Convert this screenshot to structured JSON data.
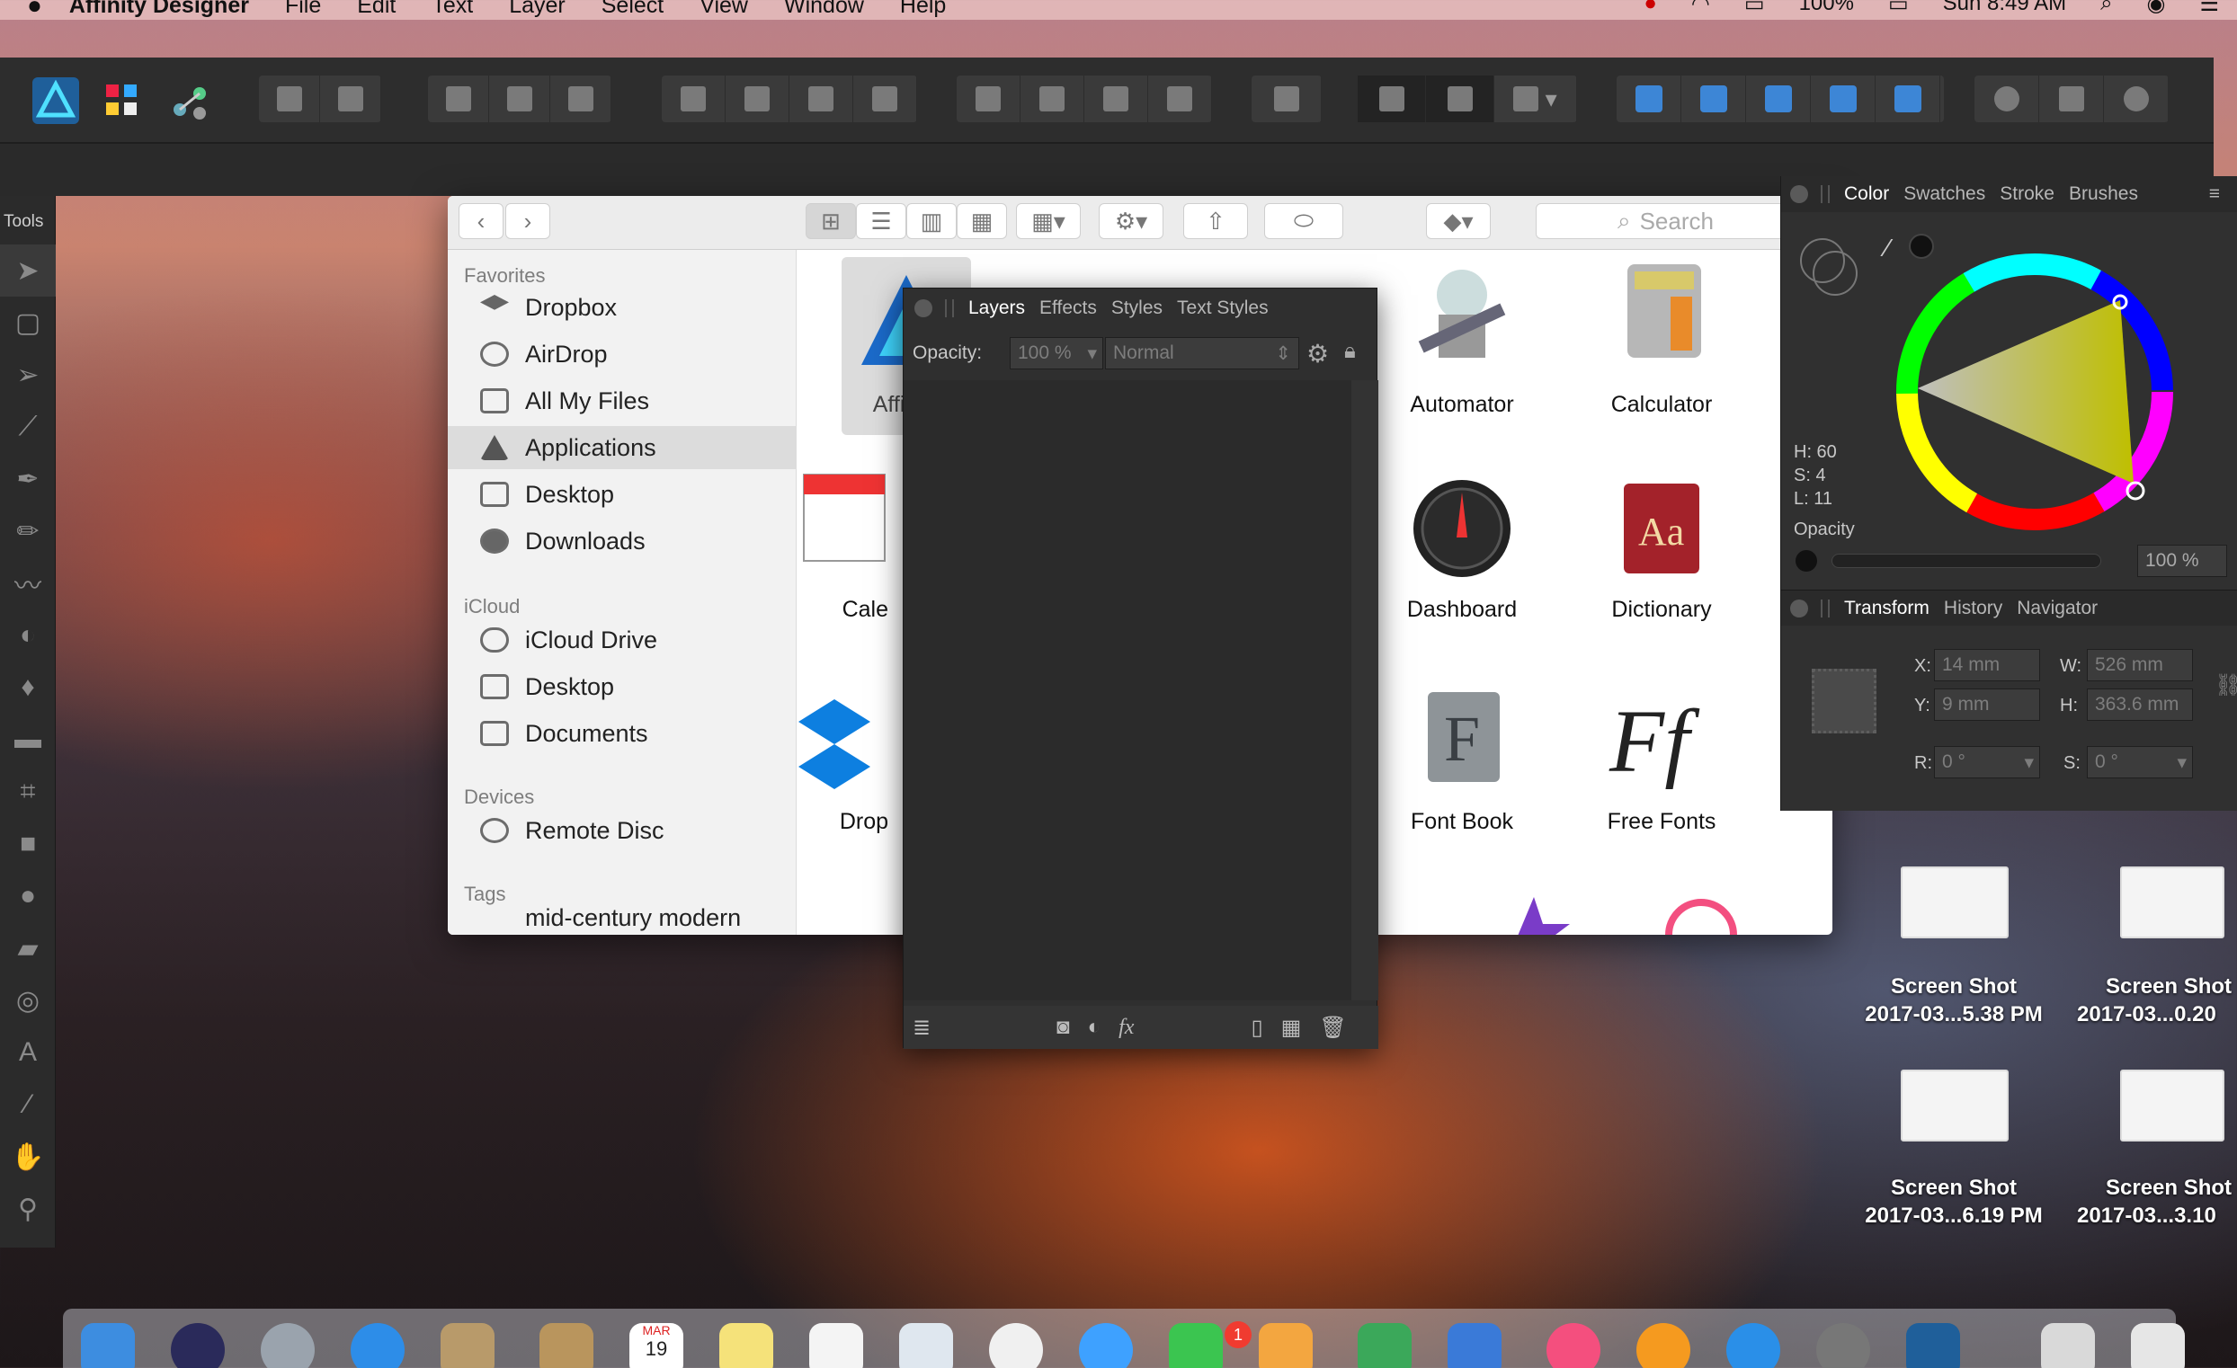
{
  "menubar": {
    "apple": "",
    "app": "Affinity Designer",
    "items": [
      "File",
      "Edit",
      "Text",
      "Layer",
      "Select",
      "View",
      "Window",
      "Help"
    ],
    "battery": "100%",
    "clock": "Sun 8:49 AM"
  },
  "tools": {
    "title": "Tools"
  },
  "finder": {
    "search_placeholder": "Search",
    "sections": {
      "favorites": "Favorites",
      "icloud": "iCloud",
      "devices": "Devices",
      "tags": "Tags"
    },
    "favorites": [
      "Dropbox",
      "AirDrop",
      "All My Files",
      "Applications",
      "Desktop",
      "Downloads"
    ],
    "icloud": [
      "iCloud Drive",
      "Desktop",
      "Documents"
    ],
    "devices": [
      "Remote Disc"
    ],
    "tags": [
      "mid-century modern"
    ],
    "apps": [
      "Affinity",
      "Automator",
      "Calculator",
      "Cale",
      "Dashboard",
      "Dictionary",
      "Drop",
      "Font Book",
      "Free Fonts"
    ]
  },
  "layers": {
    "tabs": [
      "Layers",
      "Effects",
      "Styles",
      "Text Styles"
    ],
    "opacity_label": "Opacity:",
    "opacity": "100 %",
    "blend": "Normal"
  },
  "color": {
    "tabs": [
      "Color",
      "Swatches",
      "Stroke",
      "Brushes"
    ],
    "h": "H: 60",
    "s": "S: 4",
    "l": "L: 11",
    "opacity_label": "Opacity",
    "opacity": "100 %"
  },
  "transform": {
    "tabs": [
      "Transform",
      "History",
      "Navigator"
    ],
    "x_label": "X:",
    "x": "14 mm",
    "y_label": "Y:",
    "y": "9 mm",
    "w_label": "W:",
    "w": "526 mm",
    "h_label": "H:",
    "h": "363.6 mm",
    "r_label": "R:",
    "r": "0 °",
    "s_label": "S:",
    "s": "0 °"
  },
  "desktop": [
    {
      "line1": "Screen Shot",
      "line2": "2017-03...5.38 PM"
    },
    {
      "line1": "Screen Shot",
      "line2": "2017-03...0.20"
    },
    {
      "line1": "Screen Shot",
      "line2": "2017-03...6.19 PM"
    },
    {
      "line1": "Screen Shot",
      "line2": "2017-03...3.10"
    }
  ],
  "dock": {
    "calendar_month": "MAR",
    "calendar_day": "19",
    "badge": "1"
  }
}
